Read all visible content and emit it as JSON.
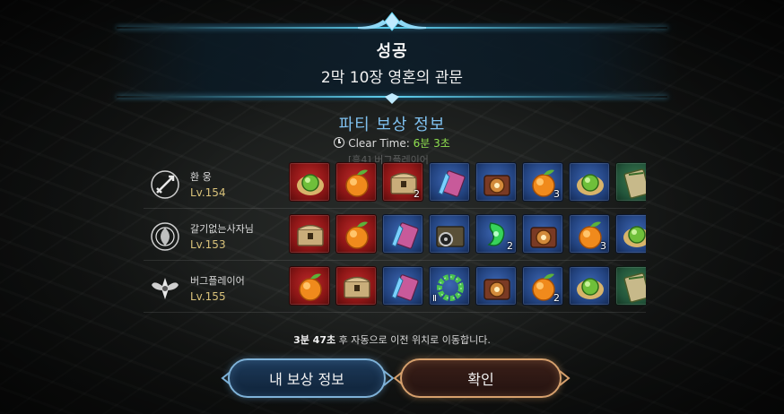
{
  "header": {
    "result": "성공",
    "stage": "2막 10장 영혼의 관문"
  },
  "party_reward": {
    "title": "파티 보상 정보",
    "clear_time_label": "Clear Time:",
    "clear_time_value": "6분 3초",
    "ghost_text": "[흥4] 버그플레이어"
  },
  "players": [
    {
      "name": "환 웅",
      "level": "Lv.154",
      "emblem": "sword-crest-icon",
      "items": [
        {
          "icon": "green-orb-icon",
          "bg": "red",
          "qty": ""
        },
        {
          "icon": "orange-fruit-icon",
          "bg": "red",
          "qty": ""
        },
        {
          "icon": "treasure-chest-icon",
          "bg": "red",
          "qty": "2"
        },
        {
          "icon": "crystal-scroll-icon",
          "bg": "blue",
          "qty": ""
        },
        {
          "icon": "bronze-chest-icon",
          "bg": "blue",
          "qty": ""
        },
        {
          "icon": "orange-fruit-icon",
          "bg": "blue",
          "qty": "3"
        },
        {
          "icon": "green-orb-icon",
          "bg": "blue",
          "qty": ""
        },
        {
          "icon": "green-scroll-icon",
          "bg": "green",
          "qty": ""
        }
      ]
    },
    {
      "name": "갈기없는사자님",
      "level": "Lv.153",
      "emblem": "swirl-crest-icon",
      "items": [
        {
          "icon": "treasure-chest-icon",
          "bg": "red",
          "qty": ""
        },
        {
          "icon": "orange-fruit-icon",
          "bg": "red",
          "qty": ""
        },
        {
          "icon": "crystal-scroll-icon",
          "bg": "blue",
          "qty": ""
        },
        {
          "icon": "gear-chest-icon",
          "bg": "blue",
          "qty": ""
        },
        {
          "icon": "jade-pendant-icon",
          "bg": "blue",
          "qty": "2"
        },
        {
          "icon": "bronze-chest-icon",
          "bg": "blue",
          "qty": ""
        },
        {
          "icon": "orange-fruit-icon",
          "bg": "blue",
          "qty": "3"
        },
        {
          "icon": "green-orb-icon",
          "bg": "blue",
          "qty": ""
        }
      ]
    },
    {
      "name": "버그플레이어",
      "level": "Lv.155",
      "emblem": "wing-crest-icon",
      "items": [
        {
          "icon": "orange-fruit-icon",
          "bg": "red",
          "qty": ""
        },
        {
          "icon": "treasure-chest-icon",
          "bg": "red",
          "qty": ""
        },
        {
          "icon": "crystal-scroll-icon",
          "bg": "blue",
          "qty": ""
        },
        {
          "icon": "jade-bracelet-icon",
          "bg": "blue",
          "qty": "",
          "tier": "Ⅱ"
        },
        {
          "icon": "bronze-chest-icon",
          "bg": "blue",
          "qty": ""
        },
        {
          "icon": "orange-fruit-icon",
          "bg": "blue",
          "qty": "2"
        },
        {
          "icon": "green-orb-icon",
          "bg": "blue",
          "qty": ""
        },
        {
          "icon": "green-scroll-icon",
          "bg": "green",
          "qty": ""
        }
      ]
    }
  ],
  "notice": {
    "time": "3분 47초",
    "text": "후 자동으로 이전 위치로 이동합니다."
  },
  "buttons": {
    "my_reward": "내 보상 정보",
    "confirm": "확인"
  },
  "colors": {
    "accent_blue": "#7fc0ef",
    "clear_time_green": "#8fe04f",
    "level_gold": "#d9c27a",
    "confirm_border": "#d6a06d",
    "mine_border": "#7fb2d8"
  }
}
